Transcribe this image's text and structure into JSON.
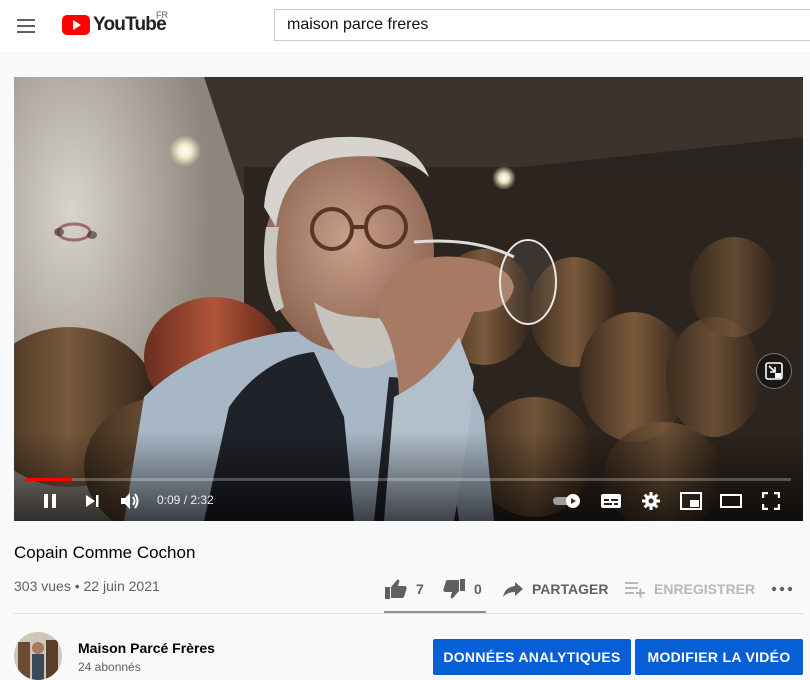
{
  "header": {
    "logo_text": "YouTube",
    "country_code": "FR",
    "search_value": "maison parce freres"
  },
  "player": {
    "current_time": "0:09",
    "duration": "2:32",
    "time_display": "0:09 / 2:32",
    "progress_fraction": 0.06,
    "state": "playing",
    "autoplay": "on",
    "icons": [
      "pause-icon",
      "next-icon",
      "volume-icon",
      "autoplay-toggle",
      "subtitles-icon",
      "settings-gear-icon",
      "miniplayer-icon",
      "theater-mode-icon",
      "fullscreen-icon",
      "miniplayer-overlay-icon"
    ]
  },
  "video": {
    "title": "Copain Comme Cochon",
    "meta": "303 vues • 22 juin 2021"
  },
  "actions": {
    "like_count": "7",
    "dislike_count": "0",
    "share_label": "PARTAGER",
    "save_label": "ENREGISTRER"
  },
  "channel": {
    "name": "Maison Parcé Frères",
    "subscribers": "24 abonnés"
  },
  "buttons": {
    "analytics": "DONNÉES ANALYTIQUES",
    "edit": "MODIFIER LA VIDÉO"
  },
  "colors": {
    "brand_red": "#ff0000",
    "action_blue": "#065fd4",
    "secondary_text": "#606060",
    "background": "#f9f9f9"
  }
}
